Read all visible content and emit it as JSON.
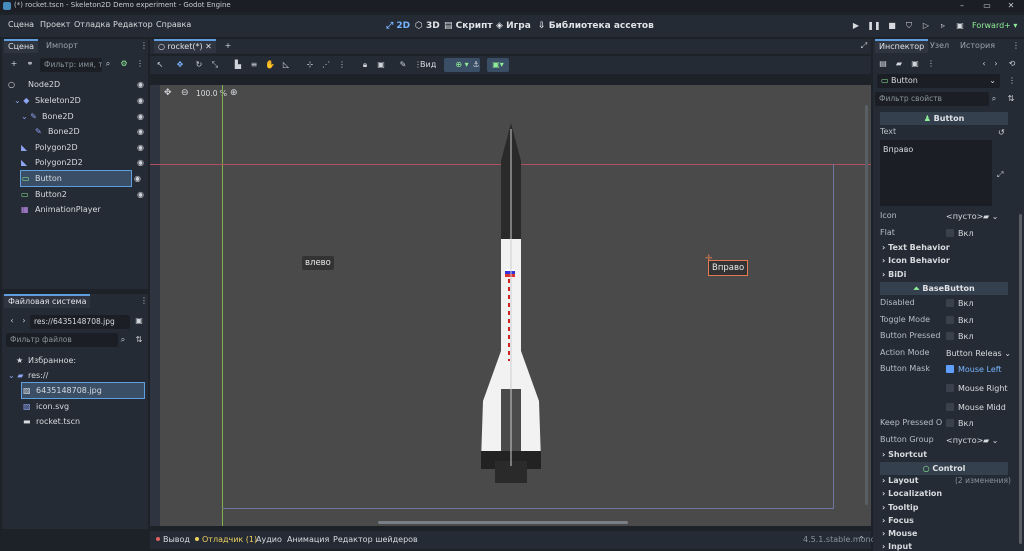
{
  "window": {
    "title": "(*) rocket.tscn - Skeleton2D Demo experiment - Godot Engine",
    "min": "–",
    "max": "▭",
    "close": "✕"
  },
  "menu": [
    "Сцена",
    "Проект",
    "Отладка",
    "Редактор",
    "Справка"
  ],
  "workspaces": [
    {
      "label": "2D",
      "icon": "2d-icon"
    },
    {
      "label": "3D",
      "icon": "3d-icon"
    },
    {
      "label": "Скрипт",
      "icon": "script-icon"
    },
    {
      "label": "Игра",
      "icon": "game-icon"
    },
    {
      "label": "Библиотека ассетов",
      "icon": "asset-library-icon"
    }
  ],
  "renderer": "Forward+",
  "scene_dock": {
    "tabs": [
      "Сцена",
      "Импорт"
    ],
    "filter_placeholder": "Фильтр: имя, т",
    "tree": [
      {
        "label": "Node2D",
        "depth": 0,
        "icon": "node2d-icon",
        "color": "#8da5f3"
      },
      {
        "label": "Skeleton2D",
        "depth": 1,
        "icon": "skeleton2d-icon",
        "color": "#8da5f3"
      },
      {
        "label": "Bone2D",
        "depth": 2,
        "icon": "bone2d-icon",
        "color": "#8da5f3"
      },
      {
        "label": "Bone2D",
        "depth": 3,
        "icon": "bone2d-icon",
        "color": "#8da5f3"
      },
      {
        "label": "Polygon2D",
        "depth": 1,
        "icon": "polygon2d-icon",
        "color": "#8da5f3"
      },
      {
        "label": "Polygon2D2",
        "depth": 1,
        "icon": "polygon2d-icon",
        "color": "#8da5f3"
      },
      {
        "label": "Button",
        "depth": 1,
        "icon": "button-icon",
        "color": "#8eef97"
      },
      {
        "label": "Button2",
        "depth": 1,
        "icon": "button-icon",
        "color": "#8eef97"
      },
      {
        "label": "AnimationPlayer",
        "depth": 1,
        "icon": "animationplayer-icon",
        "color": "#c38ef1"
      }
    ]
  },
  "filesystem_dock": {
    "title": "Файловая система",
    "path": "res://6435148708.jpg",
    "filter_placeholder": "Фильтр файлов",
    "items": [
      {
        "label": "Избранное:",
        "icon": "star-icon"
      },
      {
        "label": "res://",
        "icon": "folder-icon"
      },
      {
        "label": "6435148708.jpg",
        "icon": "image-icon"
      },
      {
        "label": "icon.svg",
        "icon": "image-icon"
      },
      {
        "label": "rocket.tscn",
        "icon": "scene-icon"
      }
    ]
  },
  "editor": {
    "scene_tab": "rocket(*)",
    "view_menu": "Вид",
    "zoom": "100.0 %",
    "left_button": "влево",
    "right_button": "Вправо"
  },
  "inspector": {
    "tabs": [
      "Инспектор",
      "Узел",
      "История"
    ],
    "node_type": "Button",
    "filter_placeholder": "Фильтр свойств",
    "section_button": "Button",
    "text_label": "Text",
    "text_value": "Вправо",
    "icon_label": "Icon",
    "empty": "<пусто>",
    "flat_label": "Flat",
    "on": "Вкл",
    "groups_button": [
      "Text Behavior",
      "Icon Behavior",
      "BiDi"
    ],
    "section_basebutton": "BaseButton",
    "disabled_label": "Disabled",
    "toggle_label": "Toggle Mode",
    "pressed_label": "Button Pressed",
    "action_label": "Action Mode",
    "action_value": "Button Releas",
    "mask_label": "Button Mask",
    "mask_left": "Mouse Left",
    "mask_right": "Mouse Right",
    "mask_middle": "Mouse Midd",
    "keep_label": "Keep Pressed O",
    "group_label": "Button Group",
    "shortcut": "Shortcut",
    "section_control": "Control",
    "groups_control": [
      "Layout",
      "Localization",
      "Tooltip",
      "Focus",
      "Mouse",
      "Input"
    ],
    "layout_changes": "(2 изменения)"
  },
  "bottom": {
    "tabs": [
      "Вывод",
      "Отладчик (1)",
      "Аудио",
      "Анимация",
      "Редактор шейдеров"
    ],
    "version": "4.5.1.stable.mono"
  }
}
